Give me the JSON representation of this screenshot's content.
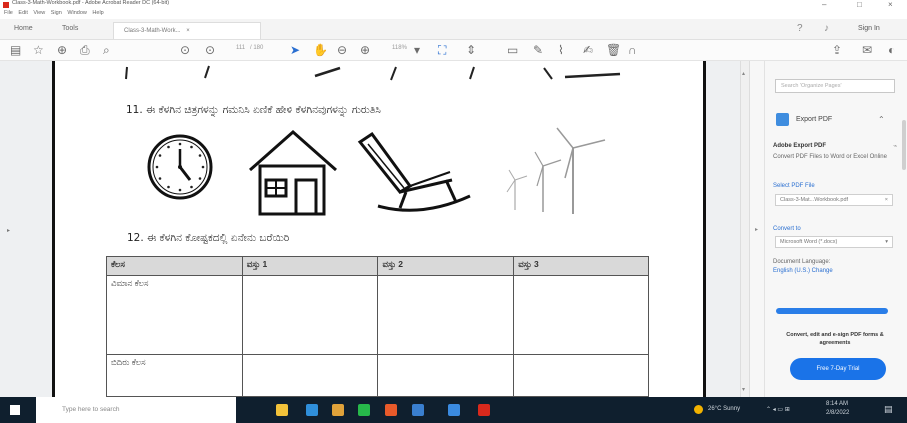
{
  "window": {
    "title": "Class-3-Math-Workbook.pdf - Adobe Acrobat Reader DC (64-bit)",
    "menu": [
      "File",
      "Edit",
      "View",
      "Sign",
      "Window",
      "Help"
    ],
    "controls": [
      "–",
      "□",
      "×"
    ]
  },
  "tabs": {
    "home": "Home",
    "tools": "Tools",
    "document": "Class-3-Math-Work...",
    "sign_in": "Sign In"
  },
  "toolbar": {
    "page_current": "111",
    "page_total": "/ 180",
    "zoom": "118%"
  },
  "document": {
    "question_11": "11. ಈ ಕೆಳಗಿನ ಚಿತ್ರಗಳನ್ನು ಗಮನಿಸಿ ಏಣಿಕೆ ಹೇಳಿ ಕೆಳಗಿನವುಗಳನ್ನು ಗುರುತಿಸಿ",
    "question_12": "12. ಈ ಕೆಳಗಿನ ಕೋಷ್ಟಕದಲ್ಲಿ ಏನೇನು ಬರೆಯಿರಿ",
    "table": {
      "headers": [
        "ಕೆಲಸ",
        "ವಸ್ತು 1",
        "ವಸ್ತು 2",
        "ವಸ್ತು 3"
      ],
      "rows": [
        [
          "ವಿಮಾನ ಕೆಲಸ",
          "",
          "",
          ""
        ],
        [
          "ಬಿದಿರು ಕೆಲಸ",
          "",
          "",
          ""
        ]
      ]
    }
  },
  "right_panel": {
    "search_placeholder": "Search 'Organize Pages'",
    "export_pdf_label": "Export PDF",
    "section_title": "Adobe Export PDF",
    "description": "Convert PDF Files to Word or Excel Online",
    "select_file_label": "Select PDF File",
    "selected_file": "Class-3-Mat...Workbook.pdf",
    "convert_to_label": "Convert to",
    "convert_to_value": "Microsoft Word (*.docx)",
    "doc_language_label": "Document Language:",
    "doc_language_value": "English (U.S.) Change",
    "promo_text": "Convert, edit and e-sign PDF forms & agreements",
    "trial_button": "Free 7-Day Trial"
  },
  "taskbar": {
    "search_placeholder": "Type here to search",
    "weather": "26°C Sunny",
    "time": "8:14 AM",
    "date": "2/8/2022"
  },
  "colors": {
    "accent": "#2a7ee8",
    "taskbar": "#0f1f2e",
    "acrobat_red": "#d9291c"
  }
}
